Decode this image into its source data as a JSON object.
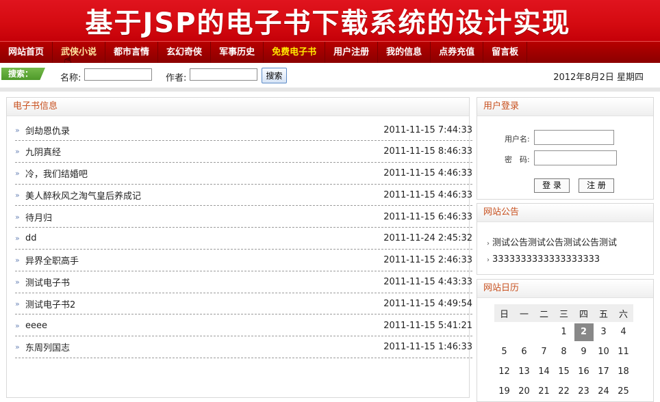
{
  "banner": {
    "title": "基于JSP的电子书下载系统的设计实现"
  },
  "nav": {
    "items": [
      {
        "label": "网站首页",
        "style": "normal"
      },
      {
        "label": "武侠小说",
        "style": "current"
      },
      {
        "label": "都市言情",
        "style": "normal"
      },
      {
        "label": "玄幻奇侠",
        "style": "normal"
      },
      {
        "label": "军事历史",
        "style": "normal"
      },
      {
        "label": "免费电子书",
        "style": "highlight"
      },
      {
        "label": "用户注册",
        "style": "normal"
      },
      {
        "label": "我的信息",
        "style": "normal"
      },
      {
        "label": "点券充值",
        "style": "normal"
      },
      {
        "label": "留言板",
        "style": "normal"
      }
    ]
  },
  "search": {
    "tag": "搜索：",
    "name_label": "名称:",
    "name_value": "",
    "author_label": "作者:",
    "author_value": "",
    "button_label": "搜索",
    "date_text": "2012年8月2日 星期四"
  },
  "books": {
    "title": "电子书信息",
    "items": [
      {
        "title": "剑劫恩仇录",
        "time": "2011-11-15 7:44:33"
      },
      {
        "title": "九阴真经",
        "time": "2011-11-15 8:46:33"
      },
      {
        "title": "冷，我们结婚吧",
        "time": "2011-11-15 4:46:33"
      },
      {
        "title": "美人醉秋风之淘气皇后养成记",
        "time": "2011-11-15 4:46:33"
      },
      {
        "title": "待月归",
        "time": "2011-11-15 6:46:33"
      },
      {
        "title": "dd",
        "time": "2011-11-24 2:45:32"
      },
      {
        "title": "异界全职高手",
        "time": "2011-11-15 2:46:33"
      },
      {
        "title": "测试电子书",
        "time": "2011-11-15 4:43:33"
      },
      {
        "title": "测试电子书2",
        "time": "2011-11-15 4:49:54"
      },
      {
        "title": "eeee",
        "time": "2011-11-15 5:41:21"
      },
      {
        "title": "东周列国志",
        "time": "2011-11-15 1:46:33"
      }
    ]
  },
  "login": {
    "title": "用户登录",
    "username_label": "用户名:",
    "password_label": "密　码:",
    "username_value": "",
    "password_value": "",
    "login_label": "登 录",
    "register_label": "注 册"
  },
  "notice": {
    "title": "网站公告",
    "items": [
      "测试公告测试公告测试公告测试",
      "3333333333333333333"
    ]
  },
  "calendar": {
    "title": "网站日历",
    "weekdays": [
      "日",
      "一",
      "二",
      "三",
      "四",
      "五",
      "六"
    ],
    "weeks": [
      [
        "",
        "",
        "",
        "1",
        "2",
        "3",
        "4"
      ],
      [
        "5",
        "6",
        "7",
        "8",
        "9",
        "10",
        "11"
      ],
      [
        "12",
        "13",
        "14",
        "15",
        "16",
        "17",
        "18"
      ],
      [
        "19",
        "20",
        "21",
        "22",
        "23",
        "24",
        "25"
      ]
    ],
    "today": "2"
  }
}
